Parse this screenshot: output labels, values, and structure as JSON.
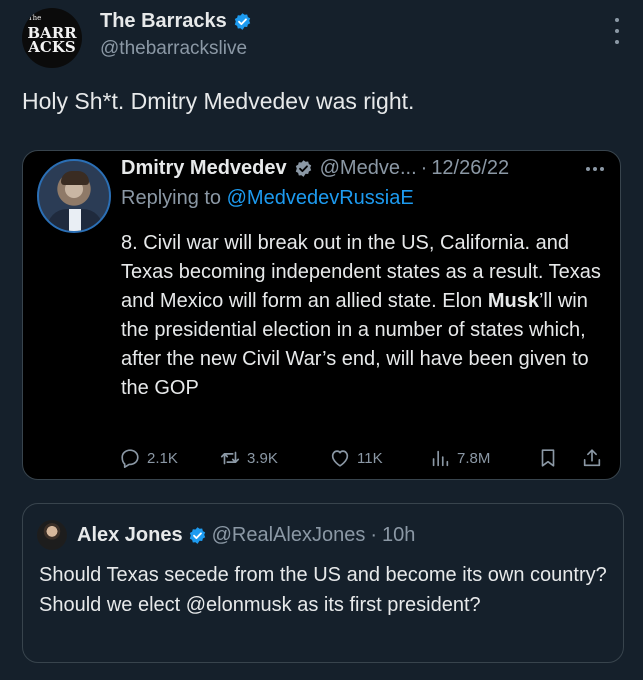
{
  "main_tweet": {
    "author": {
      "avatar_text_small": "The",
      "avatar_text_line1": "BARR",
      "avatar_text_line2": "ACKS",
      "display_name": "The Barracks",
      "handle": "@thebarrackslive",
      "verified": true
    },
    "text": "Holy Sh*t. Dmitry Medvedev was right."
  },
  "quoted_tweet": {
    "author": {
      "display_name": "Dmitry Medvedev",
      "handle_truncated": "@Medve...",
      "separator": "·",
      "date": "12/26/22",
      "verified_badge": "gray-check"
    },
    "replying_prefix": "Replying to ",
    "replying_to": "@MedvedevRussiaE",
    "text_before_bold": "8. Civil war will break out in the US, California. and Texas becoming independent states as a result. Texas and Mexico will form an allied state. Elon ",
    "text_bold": "Musk",
    "text_after_bold": "’ll win the presidential election in a number of states which, after the new Civil War’s end, will have been given to the GOP",
    "actions": {
      "replies": "2.1K",
      "retweets": "3.9K",
      "likes": "11K",
      "views": "7.8M"
    }
  },
  "reply_tweet": {
    "author": {
      "display_name": "Alex Jones",
      "handle": "@RealAlexJones",
      "separator": "·",
      "time": "10h",
      "verified": true
    },
    "text": "Should Texas secede from the US and become its own country? Should we elect @elonmusk as its first president?"
  },
  "colors": {
    "background": "#15202b",
    "card_background": "#000000",
    "accent_blue": "#1d9bf0",
    "muted_text": "#8b98a5",
    "primary_text": "#e7e9ea",
    "border": "#38444d"
  },
  "icons": [
    "verified-badge-icon",
    "more-icon",
    "reply-icon",
    "retweet-icon",
    "like-icon",
    "views-icon",
    "bookmark-icon",
    "share-icon"
  ]
}
